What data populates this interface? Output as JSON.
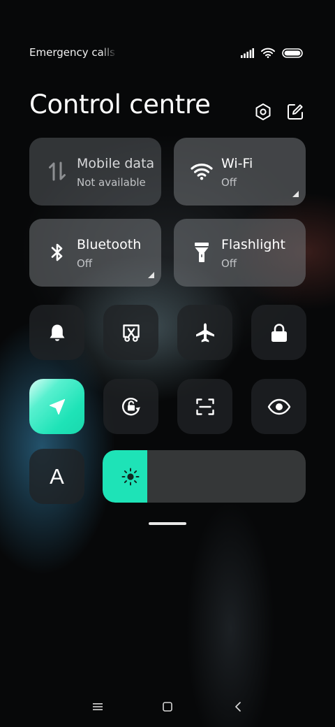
{
  "status_bar": {
    "carrier_text": "Emergency calls only",
    "icons": [
      "signal-icon",
      "wifi-icon",
      "battery-icon"
    ]
  },
  "header": {
    "title": "Control centre",
    "icons": [
      "settings-icon",
      "edit-icon"
    ]
  },
  "tiles": [
    {
      "label": "Mobile data",
      "status": "Not available",
      "icon": "mobile-data-icon",
      "state": "disabled"
    },
    {
      "label": "Wi-Fi",
      "status": "Off",
      "icon": "wifi-icon",
      "state": "off"
    },
    {
      "label": "Bluetooth",
      "status": "Off",
      "icon": "bluetooth-icon",
      "state": "off"
    },
    {
      "label": "Flashlight",
      "status": "Off",
      "icon": "flashlight-icon",
      "state": "off"
    }
  ],
  "quick_toggles": [
    {
      "icon": "bell-icon",
      "active": false
    },
    {
      "icon": "screenshot-icon",
      "active": false
    },
    {
      "icon": "airplane-icon",
      "active": false
    },
    {
      "icon": "lock-icon",
      "active": false
    },
    {
      "icon": "location-icon",
      "active": true
    },
    {
      "icon": "rotation-lock-icon",
      "active": false
    },
    {
      "icon": "scanner-icon",
      "active": false
    },
    {
      "icon": "eye-icon",
      "active": false
    }
  ],
  "text_size_button": {
    "label": "A"
  },
  "brightness": {
    "level": 0.22
  },
  "navbar": {
    "icons": [
      "menu-icon",
      "home-icon",
      "back-icon"
    ]
  },
  "colors": {
    "accent": "#1ee3b7",
    "tile_bg": "#73767a"
  }
}
